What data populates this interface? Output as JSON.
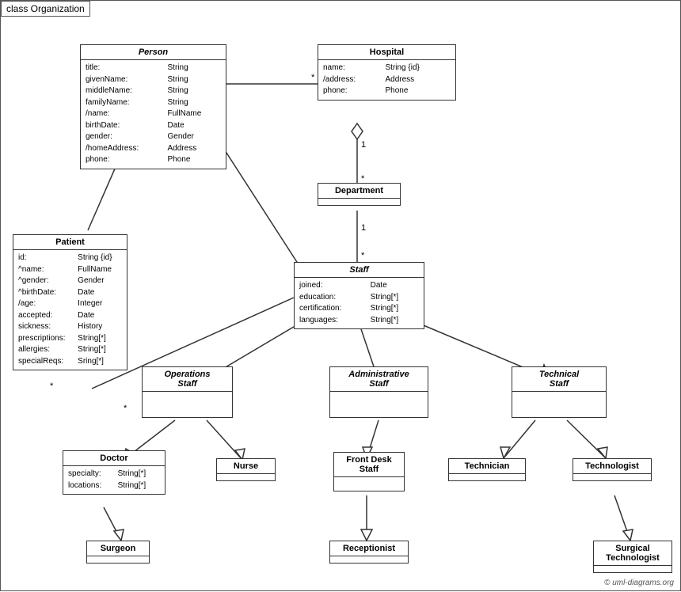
{
  "title": "class Organization",
  "classes": {
    "person": {
      "name": "Person",
      "italic": true,
      "attrs": [
        [
          "title:",
          "String"
        ],
        [
          "givenName:",
          "String"
        ],
        [
          "middleName:",
          "String"
        ],
        [
          "familyName:",
          "String"
        ],
        [
          "/name:",
          "FullName"
        ],
        [
          "birthDate:",
          "Date"
        ],
        [
          "gender:",
          "Gender"
        ],
        [
          "/homeAddress:",
          "Address"
        ],
        [
          "phone:",
          "Phone"
        ]
      ]
    },
    "hospital": {
      "name": "Hospital",
      "italic": false,
      "attrs": [
        [
          "name:",
          "String {id}"
        ],
        [
          "/address:",
          "Address"
        ],
        [
          "phone:",
          "Phone"
        ]
      ]
    },
    "department": {
      "name": "Department",
      "italic": false,
      "attrs": []
    },
    "staff": {
      "name": "Staff",
      "italic": true,
      "attrs": [
        [
          "joined:",
          "Date"
        ],
        [
          "education:",
          "String[*]"
        ],
        [
          "certification:",
          "String[*]"
        ],
        [
          "languages:",
          "String[*]"
        ]
      ]
    },
    "patient": {
      "name": "Patient",
      "italic": false,
      "attrs": [
        [
          "id:",
          "String {id}"
        ],
        [
          "^name:",
          "FullName"
        ],
        [
          "^gender:",
          "Gender"
        ],
        [
          "^birthDate:",
          "Date"
        ],
        [
          "/age:",
          "Integer"
        ],
        [
          "accepted:",
          "Date"
        ],
        [
          "sickness:",
          "History"
        ],
        [
          "prescriptions:",
          "String[*]"
        ],
        [
          "allergies:",
          "String[*]"
        ],
        [
          "specialReqs:",
          "Sring[*]"
        ]
      ]
    },
    "operations_staff": {
      "name": "Operations Staff",
      "italic": true,
      "attrs": []
    },
    "administrative_staff": {
      "name": "Administrative Staff",
      "italic": true,
      "attrs": []
    },
    "technical_staff": {
      "name": "Technical Staff",
      "italic": true,
      "attrs": []
    },
    "doctor": {
      "name": "Doctor",
      "italic": false,
      "attrs": [
        [
          "specialty:",
          "String[*]"
        ],
        [
          "locations:",
          "String[*]"
        ]
      ]
    },
    "nurse": {
      "name": "Nurse",
      "italic": false,
      "attrs": []
    },
    "front_desk_staff": {
      "name": "Front Desk Staff",
      "italic": false,
      "attrs": []
    },
    "technician": {
      "name": "Technician",
      "italic": false,
      "attrs": []
    },
    "technologist": {
      "name": "Technologist",
      "italic": false,
      "attrs": []
    },
    "surgeon": {
      "name": "Surgeon",
      "italic": false,
      "attrs": []
    },
    "receptionist": {
      "name": "Receptionist",
      "italic": false,
      "attrs": []
    },
    "surgical_technologist": {
      "name": "Surgical Technologist",
      "italic": false,
      "attrs": []
    }
  },
  "copyright": "© uml-diagrams.org"
}
